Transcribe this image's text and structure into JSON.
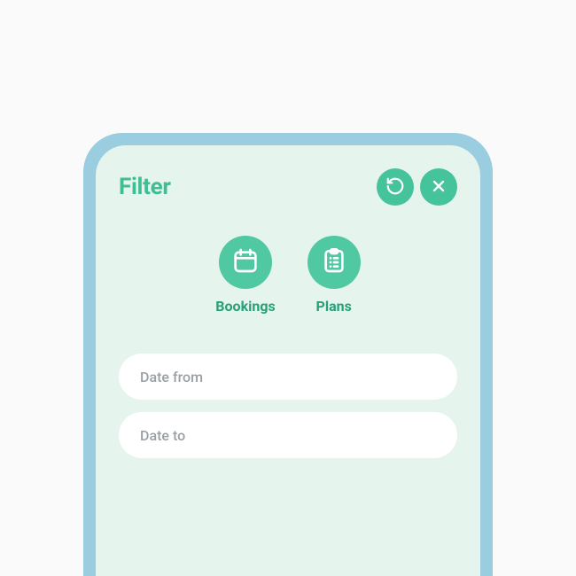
{
  "colors": {
    "accent": "#45c39a",
    "categoryCircle": "#50c8a1",
    "textAccent": "#29a07a",
    "screenBg": "#e5f4ec",
    "deviceFrame": "#9acde0"
  },
  "header": {
    "title": "Filter"
  },
  "categories": [
    {
      "icon": "calendar-icon",
      "label": "Bookings"
    },
    {
      "icon": "clipboard-icon",
      "label": "Plans"
    }
  ],
  "inputs": {
    "dateFrom": {
      "placeholder": "Date from",
      "value": ""
    },
    "dateTo": {
      "placeholder": "Date to",
      "value": ""
    }
  }
}
